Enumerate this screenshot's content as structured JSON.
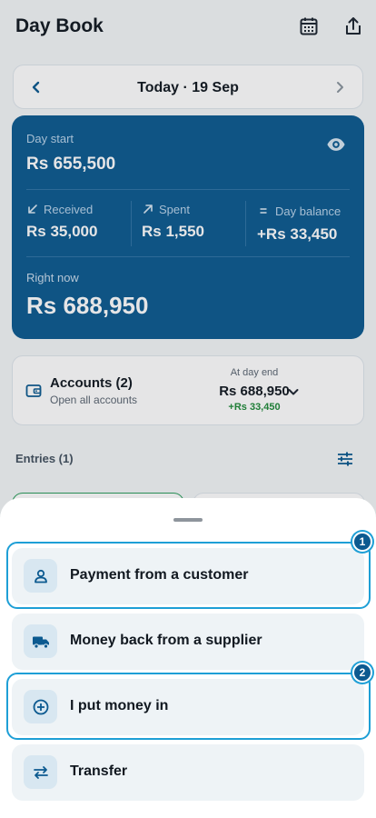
{
  "header": {
    "title": "Day Book",
    "icons": [
      "calendar-icon",
      "share-icon"
    ]
  },
  "date_bar": {
    "label": "Today · 19 Sep"
  },
  "summary": {
    "day_start_label": "Day start",
    "day_start_value": "Rs 655,500",
    "received_label": "Received",
    "received_value": "Rs 35,000",
    "spent_label": "Spent",
    "spent_value": "Rs 1,550",
    "balance_label": "Day balance",
    "balance_value": "+Rs 33,450",
    "right_now_label": "Right now",
    "right_now_value": "Rs 688,950"
  },
  "accounts": {
    "title": "Accounts (2)",
    "subtitle": "Open all accounts",
    "day_end_label": "At day end",
    "day_end_value": "Rs 688,950",
    "day_end_delta": "+Rs 33,450"
  },
  "entries": {
    "label": "Entries (1)"
  },
  "sheet": {
    "options": [
      {
        "label": "Payment from a customer",
        "icon": "person-icon"
      },
      {
        "label": "Money back from a supplier",
        "icon": "truck-icon"
      },
      {
        "label": "I put money in",
        "icon": "plus-circle-icon"
      },
      {
        "label": "Transfer",
        "icon": "transfer-arrows-icon"
      }
    ],
    "badges": [
      "1",
      "2"
    ]
  },
  "colors": {
    "card_bg": "#0c5a90",
    "accent": "#1e9fd6",
    "positive": "#1f8a3a"
  }
}
